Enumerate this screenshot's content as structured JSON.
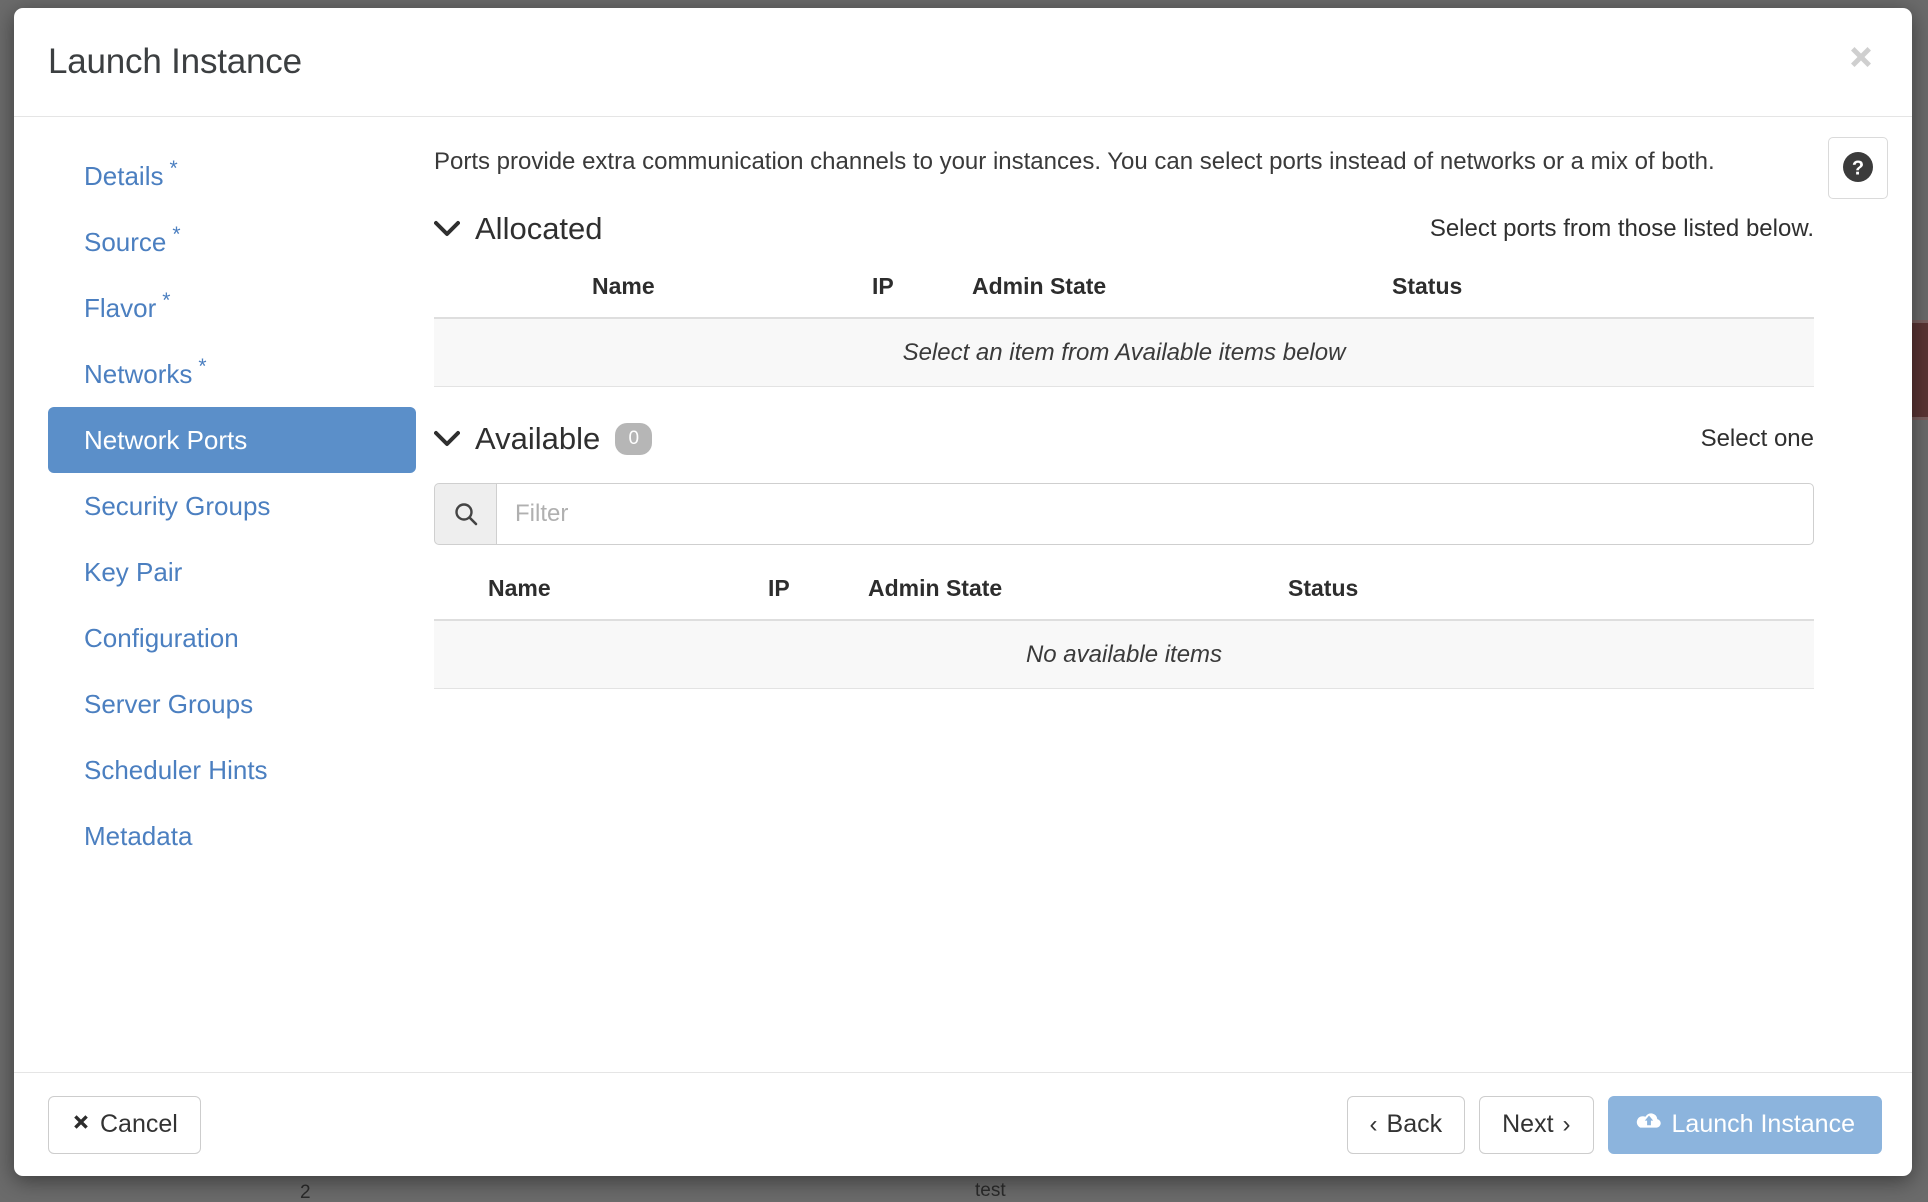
{
  "modal": {
    "title": "Launch Instance",
    "close_icon": "close-icon"
  },
  "sidebar": {
    "items": [
      {
        "label": "Details",
        "required": "*",
        "active": false
      },
      {
        "label": "Source",
        "required": "*",
        "active": false
      },
      {
        "label": "Flavor",
        "required": "*",
        "active": false
      },
      {
        "label": "Networks",
        "required": "*",
        "active": false
      },
      {
        "label": "Network Ports",
        "required": "",
        "active": true
      },
      {
        "label": "Security Groups",
        "required": "",
        "active": false
      },
      {
        "label": "Key Pair",
        "required": "",
        "active": false
      },
      {
        "label": "Configuration",
        "required": "",
        "active": false
      },
      {
        "label": "Server Groups",
        "required": "",
        "active": false
      },
      {
        "label": "Scheduler Hints",
        "required": "",
        "active": false
      },
      {
        "label": "Metadata",
        "required": "",
        "active": false
      }
    ]
  },
  "main": {
    "intro": "Ports provide extra communication channels to your instances. You can select ports instead of networks or a mix of both.",
    "help_icon": "help-icon",
    "allocated": {
      "title": "Allocated",
      "hint": "Select ports from those listed below.",
      "columns": [
        "Name",
        "IP",
        "Admin State",
        "Status"
      ],
      "empty_message": "Select an item from Available items below",
      "rows": []
    },
    "available": {
      "title": "Available",
      "count": "0",
      "hint": "Select one",
      "filter_placeholder": "Filter",
      "filter_value": "",
      "search_icon": "search-icon",
      "columns": [
        "Name",
        "IP",
        "Admin State",
        "Status"
      ],
      "empty_message": "No available items",
      "rows": []
    }
  },
  "footer": {
    "cancel_label": "Cancel",
    "back_label": "Back",
    "next_label": "Next",
    "launch_label": "Launch Instance",
    "back_chevron": "‹",
    "next_chevron": "›"
  },
  "backdrop": {
    "text_left": "2",
    "text_center": "test"
  },
  "colors": {
    "accent": "#5b8fc9",
    "link": "#4b7fc0",
    "primary_button": "#8cb4dd",
    "badge": "#b6b6b6"
  }
}
